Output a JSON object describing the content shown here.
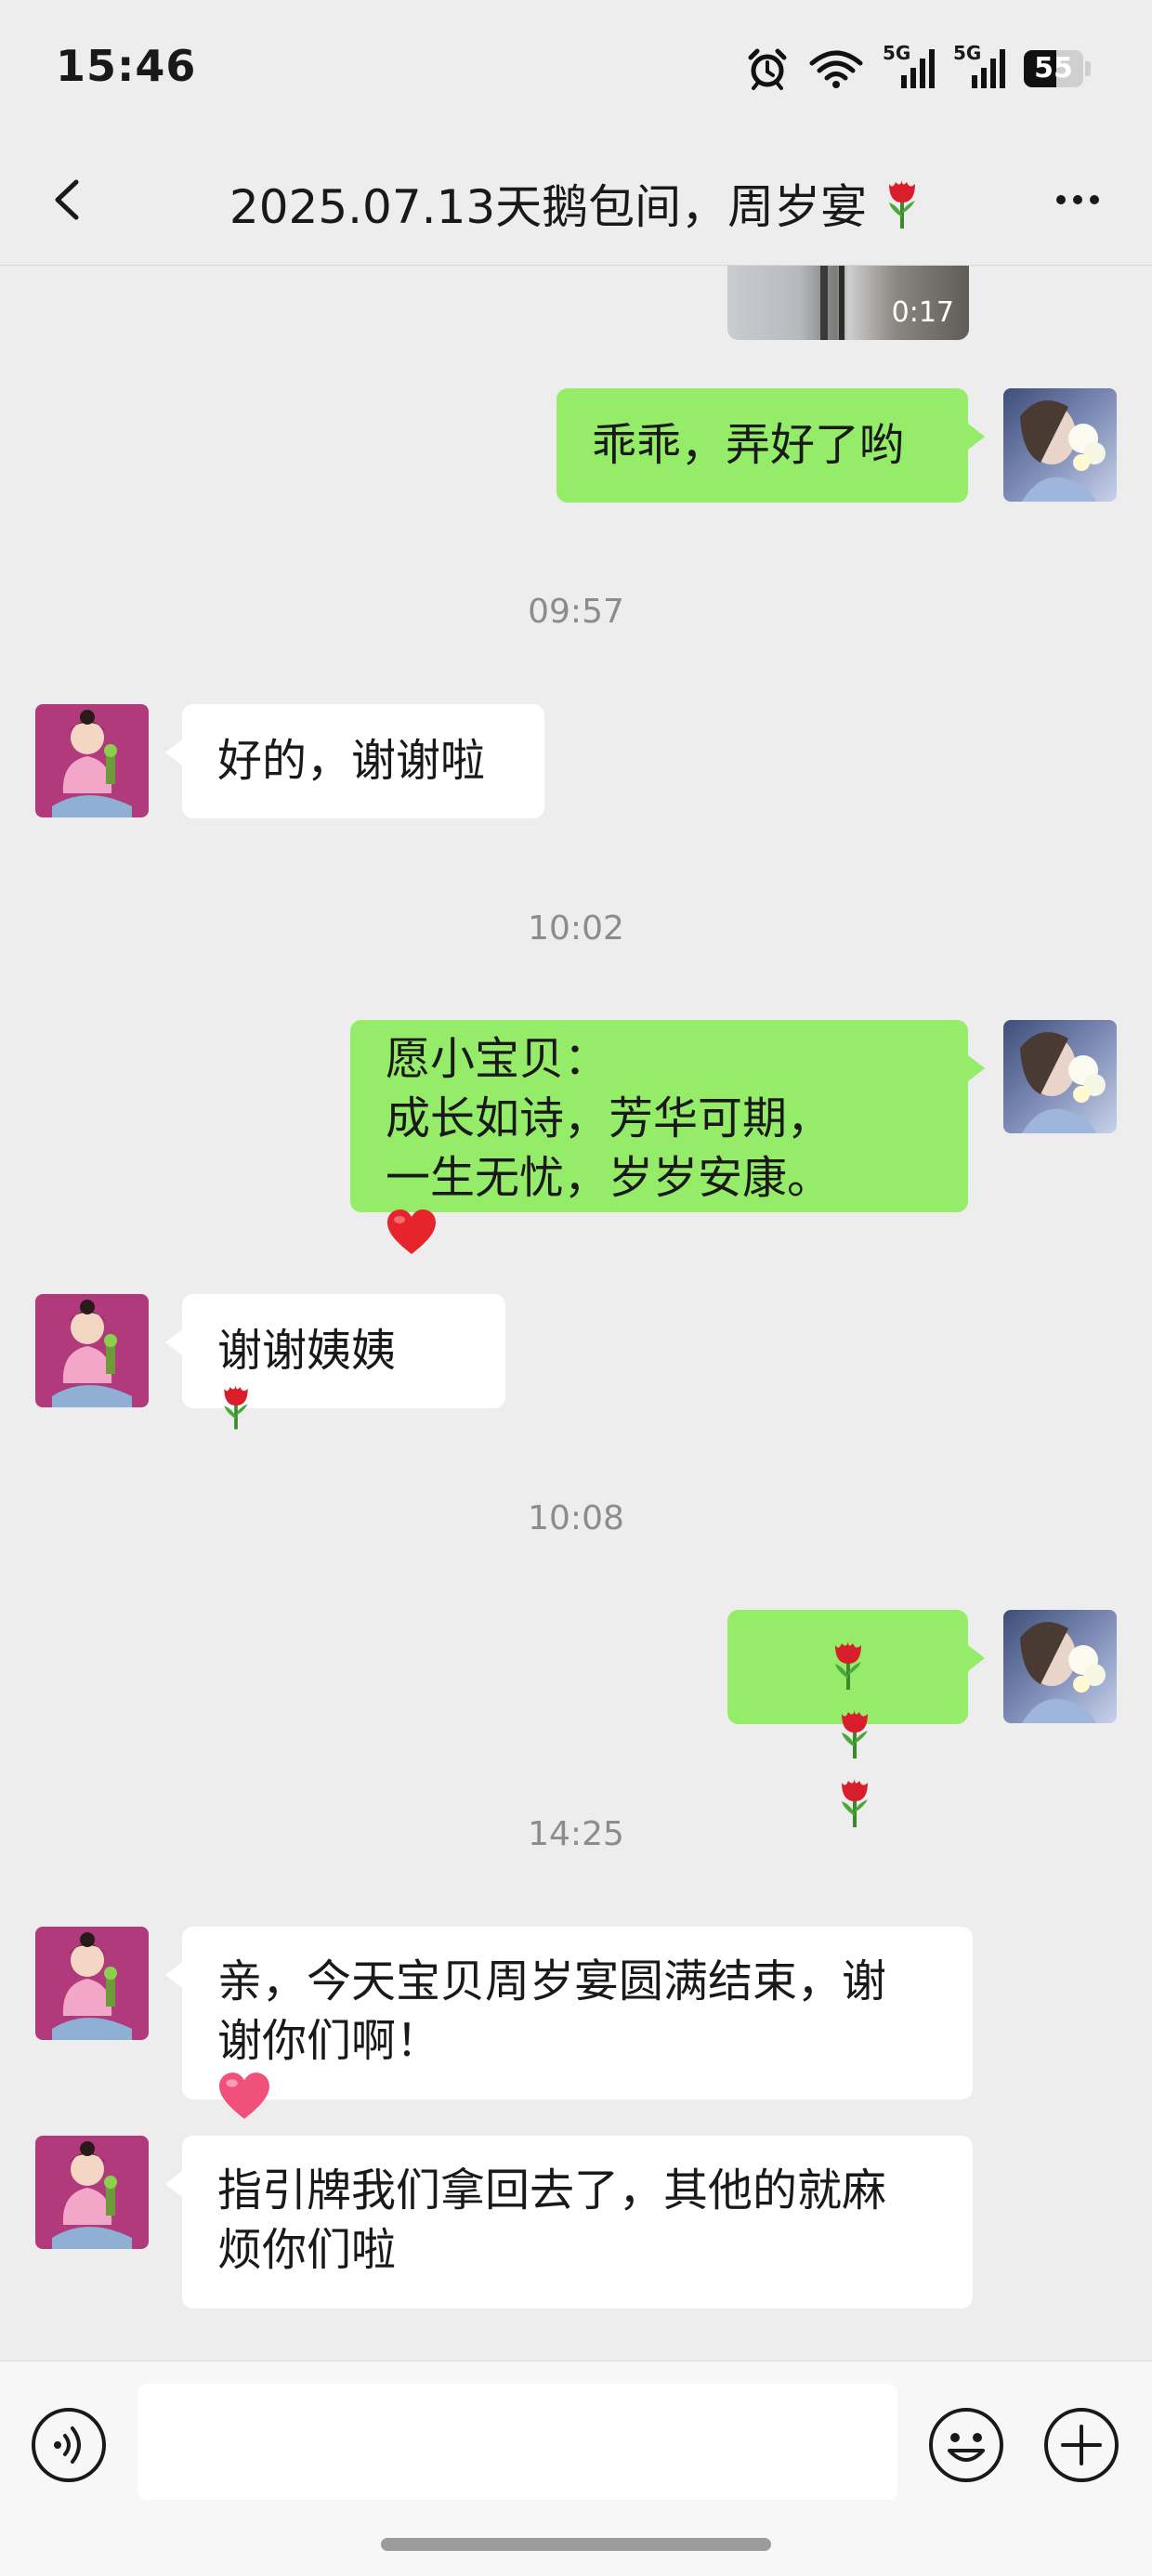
{
  "status_bar": {
    "time": "15:46",
    "battery_level": "55",
    "signal_1_label": "5G",
    "signal_2_label": "5G"
  },
  "nav": {
    "title": "2025.07.13天鹅包间，周岁宴",
    "title_emoji_icon": "tulip-icon",
    "back_icon": "chevron-left-icon",
    "more_icon": "more-dots-icon"
  },
  "chat": {
    "video_duration": "0:17",
    "messages": [
      {
        "side": "right",
        "text": "乖乖，弄好了哟"
      },
      {
        "timestamp": "09:57"
      },
      {
        "side": "left",
        "text": "好的，谢谢啦"
      },
      {
        "timestamp": "10:02"
      },
      {
        "side": "right",
        "lines": [
          "愿小宝贝：",
          "成长如诗，芳华可期，",
          "一生无忧，岁岁安康。"
        ],
        "trailing_icon": "heart-icon"
      },
      {
        "side": "left",
        "text": "谢谢姨姨",
        "trailing_icon": "tulip-icon"
      },
      {
        "timestamp": "10:08"
      },
      {
        "side": "right",
        "icons": [
          "tulip-icon",
          "tulip-icon",
          "tulip-icon"
        ]
      },
      {
        "timestamp": "14:25"
      },
      {
        "side": "left",
        "lines": [
          "亲，今天宝贝周岁宴圆满结束，谢",
          "谢你们啊！"
        ],
        "trailing_icon": "pink-heart-icon"
      },
      {
        "side": "left",
        "lines": [
          "指引牌我们拿回去了，其他的就麻",
          "烦你们啦"
        ]
      }
    ]
  },
  "input_bar": {
    "text_value": "",
    "voice_icon": "voice-icon",
    "emoji_icon": "emoji-icon",
    "plus_icon": "plus-icon"
  },
  "colors": {
    "background": "#ededed",
    "bubble_self": "#95ec69",
    "bubble_other": "#ffffff",
    "timestamp": "#8c8c8c",
    "heart_red": "#e5242b",
    "heart_pink": "#f0507a"
  }
}
